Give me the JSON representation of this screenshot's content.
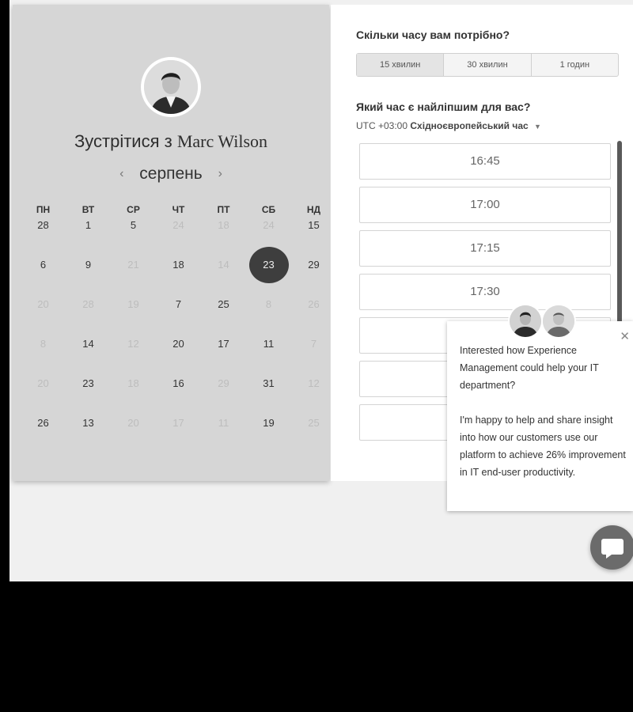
{
  "host": {
    "prefix": "Зустрітися з",
    "name": "Marc Wilson"
  },
  "calendar": {
    "month": "серпень",
    "prev_icon": "chevron-left-icon",
    "next_icon": "chevron-right-icon",
    "weekdays": [
      "ПН",
      "ВТ",
      "СР",
      "ЧТ",
      "ПТ",
      "СБ",
      "НД"
    ],
    "weeks": [
      [
        {
          "d": "28",
          "s": "on"
        },
        {
          "d": "1",
          "s": "on"
        },
        {
          "d": "5",
          "s": "on"
        },
        {
          "d": "24",
          "s": "dim"
        },
        {
          "d": "18",
          "s": "dim"
        },
        {
          "d": "24",
          "s": "dim"
        },
        {
          "d": "15",
          "s": "on"
        }
      ],
      [
        {
          "d": "6",
          "s": "on"
        },
        {
          "d": "9",
          "s": "on"
        },
        {
          "d": "21",
          "s": "dim"
        },
        {
          "d": "18",
          "s": "on"
        },
        {
          "d": "14",
          "s": "dim"
        },
        {
          "d": "23",
          "s": "sel"
        },
        {
          "d": "29",
          "s": "on"
        }
      ],
      [
        {
          "d": "20",
          "s": "dim"
        },
        {
          "d": "28",
          "s": "dim"
        },
        {
          "d": "19",
          "s": "dim"
        },
        {
          "d": "7",
          "s": "on"
        },
        {
          "d": "25",
          "s": "on"
        },
        {
          "d": "8",
          "s": "dim"
        },
        {
          "d": "26",
          "s": "dim"
        }
      ],
      [
        {
          "d": "8",
          "s": "dim"
        },
        {
          "d": "14",
          "s": "on"
        },
        {
          "d": "12",
          "s": "dim"
        },
        {
          "d": "20",
          "s": "on"
        },
        {
          "d": "17",
          "s": "on"
        },
        {
          "d": "11",
          "s": "on"
        },
        {
          "d": "7",
          "s": "dim"
        }
      ],
      [
        {
          "d": "20",
          "s": "dim"
        },
        {
          "d": "23",
          "s": "on"
        },
        {
          "d": "18",
          "s": "dim"
        },
        {
          "d": "16",
          "s": "on"
        },
        {
          "d": "29",
          "s": "dim"
        },
        {
          "d": "31",
          "s": "on"
        },
        {
          "d": "12",
          "s": "dim"
        }
      ],
      [
        {
          "d": "26",
          "s": "on"
        },
        {
          "d": "13",
          "s": "on"
        },
        {
          "d": "20",
          "s": "dim"
        },
        {
          "d": "17",
          "s": "dim"
        },
        {
          "d": "11",
          "s": "dim"
        },
        {
          "d": "19",
          "s": "on"
        },
        {
          "d": "25",
          "s": "dim"
        }
      ]
    ]
  },
  "booking": {
    "duration_question": "Скільки часу вам потрібно?",
    "durations": [
      "15 хвилин",
      "30 хвилин",
      "1 годин"
    ],
    "selected_duration": 0,
    "time_question": "Який час є найліпшим для вас?",
    "timezone_offset": "UTC +03:00",
    "timezone_name": "Східноєвропейський час",
    "timezone_icon": "caret-down-icon",
    "slots": [
      "16:45",
      "17:00",
      "17:15",
      "17:30",
      "",
      "",
      "",
      ""
    ]
  },
  "chat": {
    "message_1": "Interested how Experience Management could help your IT department?",
    "message_2": "I'm happy to help and share insight into how our customers use our platform to achieve 26% improvement in IT end-user productivity.",
    "close_icon": "close-icon",
    "launcher_icon": "chat-bubble-icon"
  }
}
